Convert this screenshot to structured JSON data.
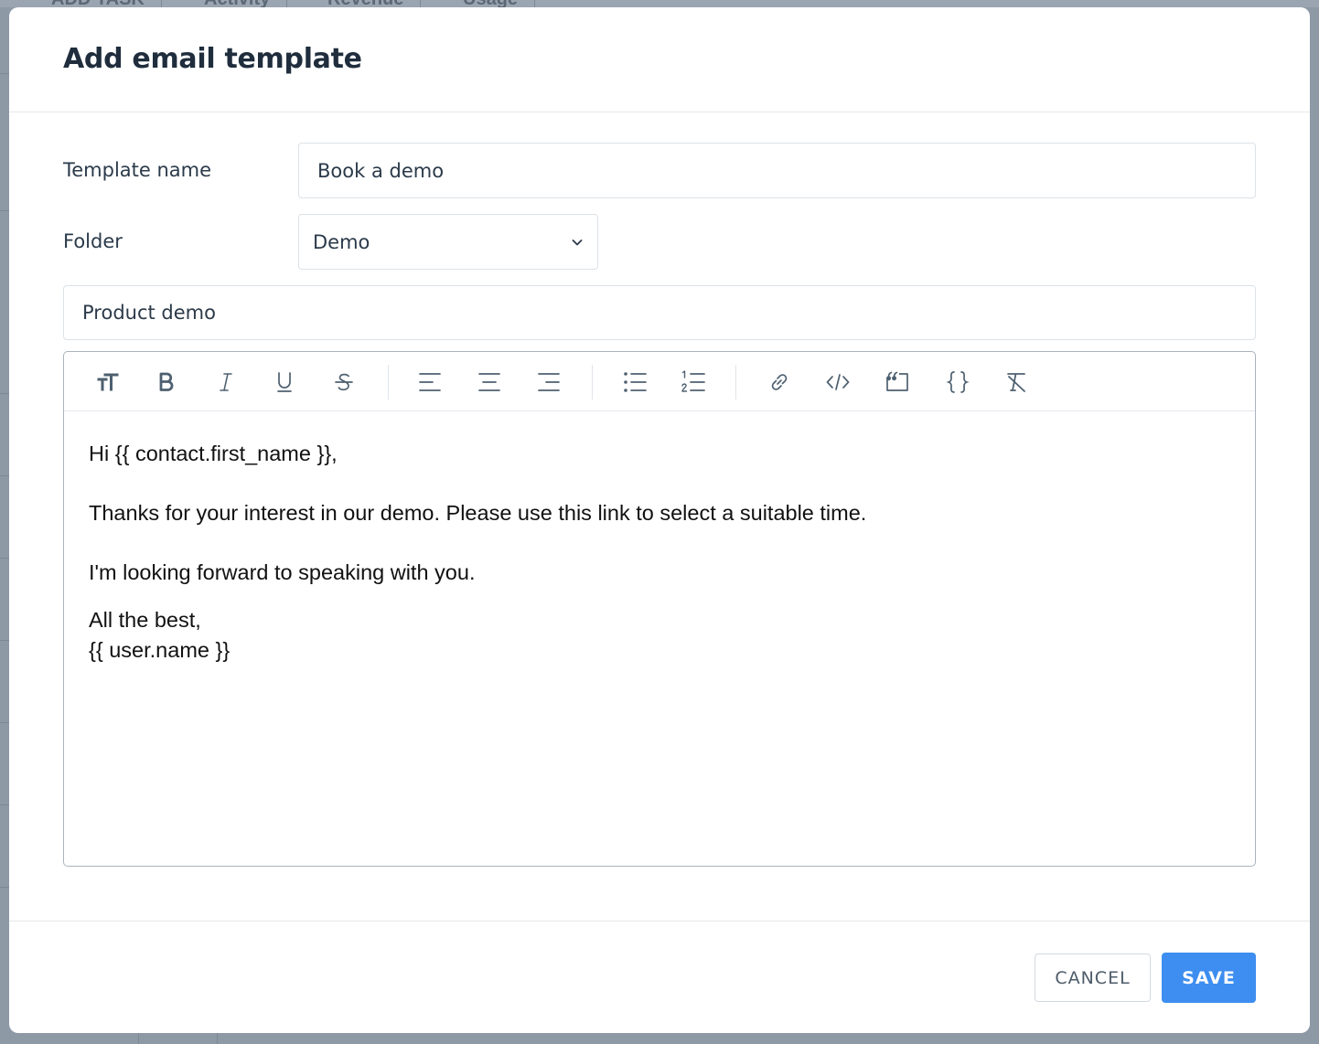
{
  "background": {
    "tabs": [
      "ADD TASK",
      "Activity",
      "Revenue",
      "Usage"
    ]
  },
  "modal": {
    "title": "Add email template",
    "template_name": {
      "label": "Template name",
      "value": "Book a demo"
    },
    "folder": {
      "label": "Folder",
      "selected": "Demo"
    },
    "subject": {
      "value": "Product demo"
    },
    "toolbar": {
      "icons": [
        "text-size-icon",
        "bold-icon",
        "italic-icon",
        "underline-icon",
        "strikethrough-icon",
        "align-left-icon",
        "align-center-icon",
        "align-right-icon",
        "bullet-list-icon",
        "numbered-list-icon",
        "link-icon",
        "code-icon",
        "blockquote-icon",
        "variable-braces-icon",
        "clear-format-icon"
      ]
    },
    "body": {
      "line1": "Hi {{ contact.first_name }},",
      "line2": "Thanks for your interest in our demo. Please use this link to select a suitable time.",
      "line3": "I'm looking forward to speaking with you.",
      "line4": "All the best,",
      "line5": "{{ user.name }}"
    },
    "footer": {
      "cancel_label": "CANCEL",
      "save_label": "SAVE"
    }
  },
  "colors": {
    "accent": "#3d8ef0",
    "title": "#1f2d3d",
    "icon": "#4e6070"
  }
}
